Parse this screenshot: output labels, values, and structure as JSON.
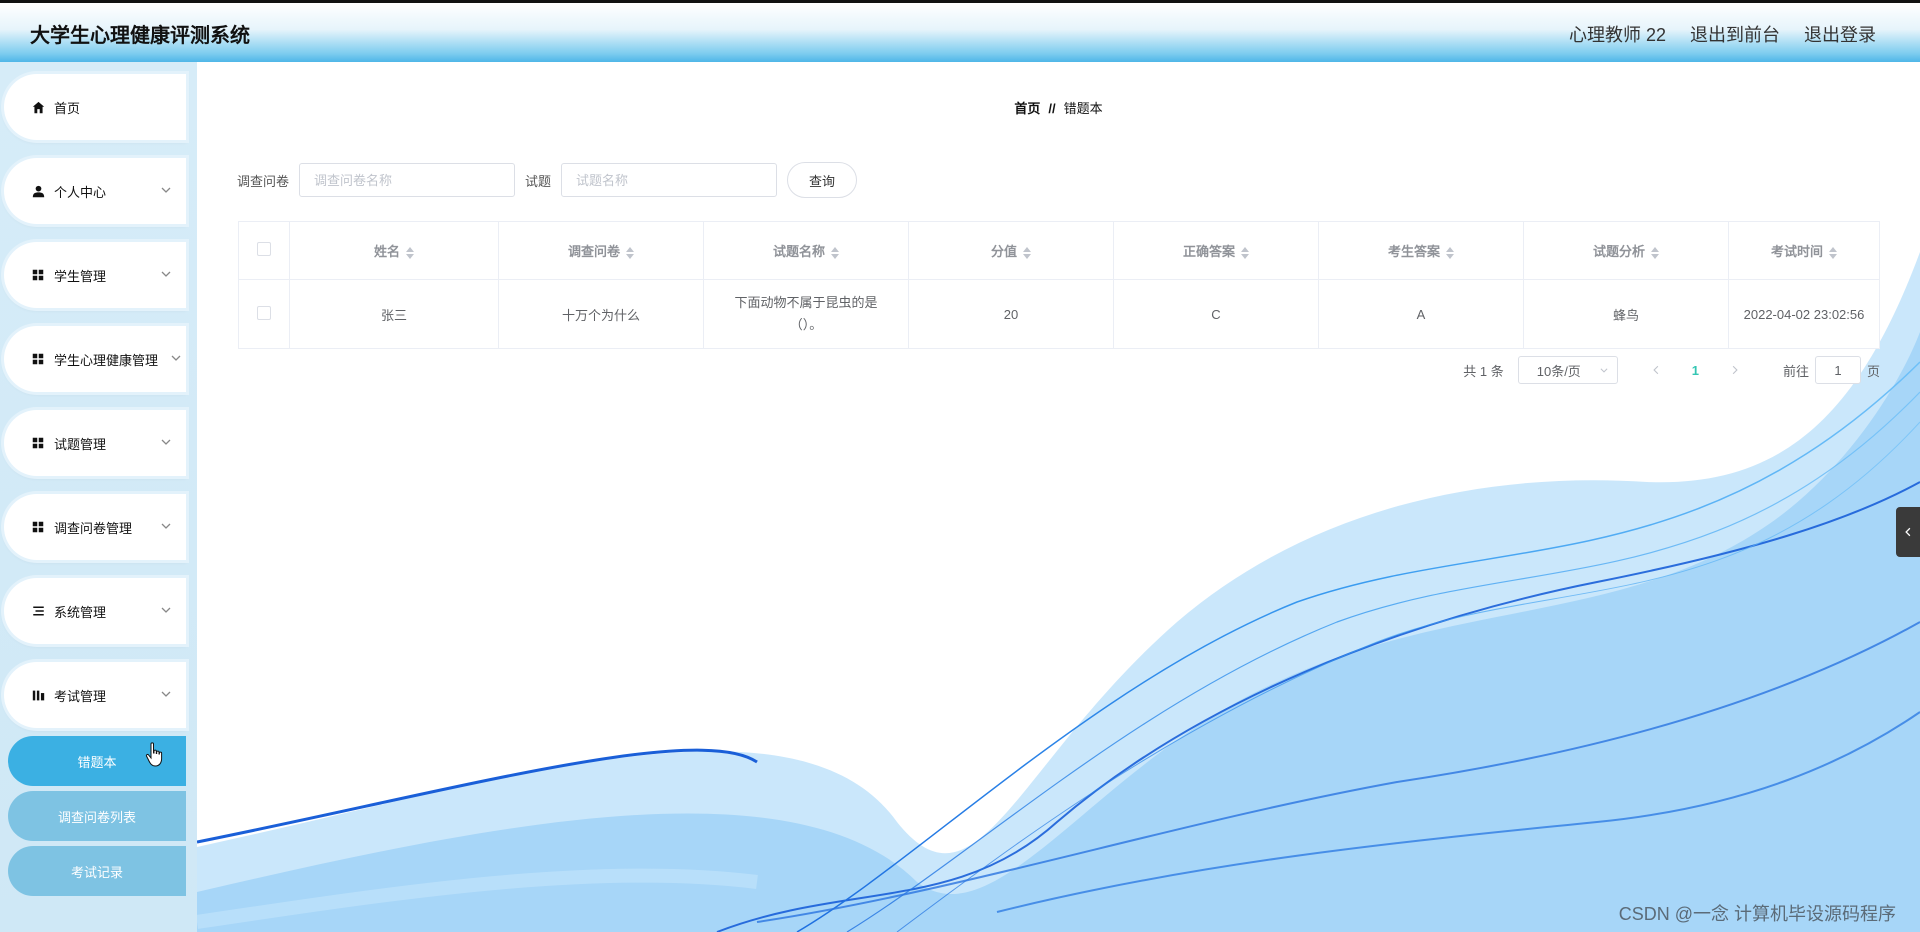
{
  "header": {
    "app_title": "大学生心理健康评测系统",
    "user": "心理教师 22",
    "exit_front": "退出到前台",
    "logout": "退出登录"
  },
  "sidebar": {
    "items": [
      {
        "label": "首页",
        "icon": "home-icon"
      },
      {
        "label": "个人中心",
        "icon": "user-icon"
      },
      {
        "label": "学生管理",
        "icon": "grid-icon"
      },
      {
        "label": "学生心理健康管理",
        "icon": "grid-icon"
      },
      {
        "label": "试题管理",
        "icon": "grid-icon"
      },
      {
        "label": "调查问卷管理",
        "icon": "grid-icon"
      },
      {
        "label": "系统管理",
        "icon": "list-icon"
      },
      {
        "label": "考试管理",
        "icon": "chart-icon"
      }
    ],
    "sub_items": [
      {
        "label": "错题本",
        "active": true
      },
      {
        "label": "调查问卷列表",
        "active": false
      },
      {
        "label": "考试记录",
        "active": false
      }
    ]
  },
  "breadcrumb": {
    "home": "首页",
    "separator": "//",
    "current": "错题本"
  },
  "search": {
    "survey_label": "调查问卷",
    "survey_placeholder": "调查问卷名称",
    "question_label": "试题",
    "question_placeholder": "试题名称",
    "query_button": "查询"
  },
  "table": {
    "columns": [
      "姓名",
      "调查问卷",
      "试题名称",
      "分值",
      "正确答案",
      "考生答案",
      "试题分析",
      "考试时间"
    ],
    "rows": [
      {
        "name": "张三",
        "survey": "十万个为什么",
        "question": "下面动物不属于昆虫的是（）。",
        "score": "20",
        "correct": "C",
        "answer": "A",
        "analysis": "蜂鸟",
        "time": "2022-04-02 23:02:56"
      }
    ]
  },
  "pager": {
    "total": "共 1 条",
    "page_size": "10条/页",
    "current_page": "1",
    "goto_label": "前往",
    "goto_value": "1",
    "page_suffix": "页"
  },
  "watermark": "CSDN @一念 计算机毕设源码程序",
  "colors": {
    "accent": "#3bb0e3",
    "sub_menu": "#7ec3e3",
    "page_active": "#34c6b3"
  }
}
